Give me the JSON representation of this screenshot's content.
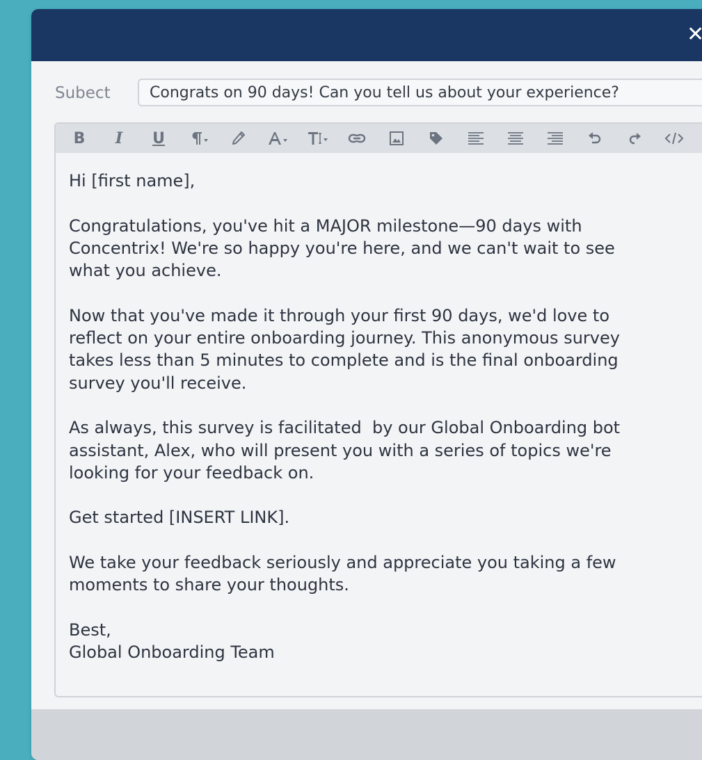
{
  "dialog": {
    "close_label": "✕"
  },
  "subject": {
    "label": "Subect",
    "value": "Congrats on 90 days! Can you tell us about your experience?"
  },
  "toolbar": {
    "buttons": [
      {
        "name": "bold-button",
        "icon": "bold-icon",
        "text": "B"
      },
      {
        "name": "italic-button",
        "icon": "italic-icon",
        "text": "I"
      },
      {
        "name": "underline-button",
        "icon": "underline-icon",
        "text": "U"
      },
      {
        "name": "paragraph-format-button",
        "icon": "paragraph-icon"
      },
      {
        "name": "text-color-button",
        "icon": "color-picker-icon"
      },
      {
        "name": "font-family-button",
        "icon": "font-icon"
      },
      {
        "name": "font-size-button",
        "icon": "text-size-icon"
      },
      {
        "name": "insert-link-button",
        "icon": "link-icon"
      },
      {
        "name": "insert-image-button",
        "icon": "image-icon"
      },
      {
        "name": "insert-tag-button",
        "icon": "tag-icon"
      },
      {
        "name": "align-left-button",
        "icon": "align-left-icon"
      },
      {
        "name": "align-center-button",
        "icon": "align-center-icon"
      },
      {
        "name": "align-right-button",
        "icon": "align-right-icon"
      },
      {
        "name": "undo-button",
        "icon": "undo-icon"
      },
      {
        "name": "redo-button",
        "icon": "redo-icon"
      },
      {
        "name": "code-view-button",
        "icon": "code-icon"
      }
    ]
  },
  "body": {
    "paragraphs": [
      [
        "Hi [first name],"
      ],
      [
        "Congratulations, you've hit a MAJOR milestone—90 days with",
        "Concentrix! We're so happy you're here, and we can't wait to see",
        "what you achieve."
      ],
      [
        "Now that you've made it through your first 90 days, we'd love to",
        "reflect on your entire onboarding journey. This anonymous survey",
        "takes less than 5 minutes to complete and is the final onboarding",
        "survey you'll receive."
      ],
      [
        "As always, this survey is facilitated  by our Global Onboarding bot",
        "assistant, Alex, who will present you with a series of topics we're",
        "looking for your feedback on."
      ],
      [
        "Get started [INSERT LINK]."
      ],
      [
        "We take your feedback seriously and appreciate you taking a few",
        "moments to share your thoughts."
      ],
      [
        "Best,",
        "Global Onboarding Team"
      ]
    ]
  },
  "colors": {
    "background": "#4aaebf",
    "header": "#1a3764",
    "toolbar": "#dcdfe3",
    "footer": "#d1d4d8"
  }
}
